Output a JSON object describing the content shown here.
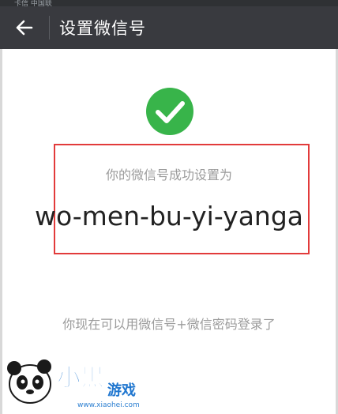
{
  "status_bar": {
    "text": "卡信 中国联"
  },
  "header": {
    "back_icon": "arrow-left-icon",
    "title": "设置微信号",
    "background": "#393a3f"
  },
  "main": {
    "success_icon": "check-circle-icon",
    "success_color": "#38b44a",
    "success_text": "你的微信号成功设置为",
    "wechat_id": "wo-men-bu-yi-yanga",
    "login_hint": "你现在可以用微信号+微信密码登录了",
    "highlight_color": "#e23b3b"
  },
  "watermark": {
    "site": "小黑游戏",
    "url": "www.xiaohei.com"
  }
}
